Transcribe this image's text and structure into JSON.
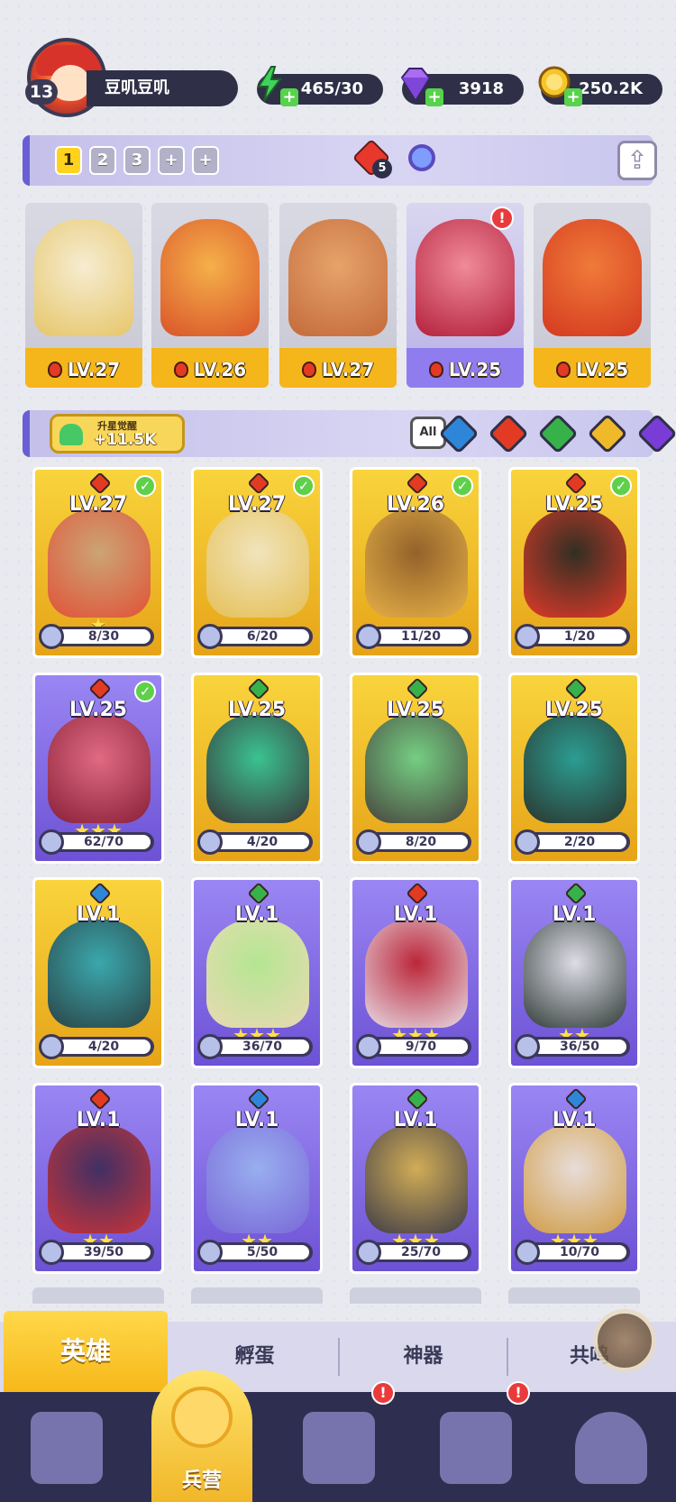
{
  "player": {
    "level": "13",
    "name": "豆叽豆叽"
  },
  "resources": [
    {
      "icon": "energy-icon",
      "value": "465/30"
    },
    {
      "icon": "diamond-icon",
      "value": "3918"
    },
    {
      "icon": "gold-coin-icon",
      "value": "250.2K"
    }
  ],
  "team_bar": {
    "slots": [
      "1",
      "2",
      "3"
    ],
    "gem_count": "5"
  },
  "team": [
    {
      "level": "LV.27",
      "element": "fire",
      "colors": [
        "#e6c66a",
        "#f6ecd0"
      ]
    },
    {
      "level": "LV.26",
      "element": "fire",
      "colors": [
        "#d9542a",
        "#f5b04a"
      ]
    },
    {
      "level": "LV.27",
      "element": "fire",
      "colors": [
        "#c46a3a",
        "#e6a36a"
      ]
    },
    {
      "level": "LV.25",
      "element": "fire",
      "colors": [
        "#b3203a",
        "#f08a9a"
      ],
      "alert": "!"
    },
    {
      "level": "LV.25",
      "element": "fire",
      "colors": [
        "#d43a1f",
        "#f07a3a"
      ]
    }
  ],
  "awaken": {
    "title": "升星觉醒",
    "value": "+11.5K"
  },
  "filters": {
    "all_label": "All",
    "elements": [
      "water",
      "fire",
      "wind",
      "light",
      "dark"
    ]
  },
  "element_colors": {
    "fire": "#e33a23",
    "water": "#2e86d9",
    "wind": "#37b24a",
    "light": "#f0b92a",
    "dark": "#7a3cd6"
  },
  "heroes": [
    {
      "level": "LV.27",
      "element": "fire",
      "bg": "gold",
      "progress": "8/30",
      "stars": "★",
      "check": true,
      "art": [
        "#c8a27a",
        "#e04a3a"
      ]
    },
    {
      "level": "LV.27",
      "element": "fire",
      "bg": "gold",
      "progress": "6/20",
      "stars": "",
      "check": true,
      "art": [
        "#f1e7c9",
        "#e4c15a"
      ]
    },
    {
      "level": "LV.26",
      "element": "fire",
      "bg": "gold",
      "progress": "11/20",
      "stars": "",
      "check": true,
      "art": [
        "#8a5a2a",
        "#e6b04a"
      ]
    },
    {
      "level": "LV.25",
      "element": "fire",
      "bg": "gold",
      "progress": "1/20",
      "stars": "",
      "check": true,
      "art": [
        "#222",
        "#e0302a"
      ]
    },
    {
      "level": "LV.25",
      "element": "fire",
      "bg": "violet",
      "progress": "62/70",
      "stars": "★★★",
      "check": true,
      "art": [
        "#e86a7a",
        "#8a1a2a"
      ]
    },
    {
      "level": "LV.25",
      "element": "wind",
      "bg": "gold",
      "progress": "4/20",
      "stars": "",
      "check": false,
      "art": [
        "#2ac39a",
        "#2a2a3a"
      ]
    },
    {
      "level": "LV.25",
      "element": "wind",
      "bg": "gold",
      "progress": "8/20",
      "stars": "",
      "check": false,
      "art": [
        "#6ad08a",
        "#3a3a40"
      ]
    },
    {
      "level": "LV.25",
      "element": "wind",
      "bg": "gold",
      "progress": "2/20",
      "stars": "",
      "check": false,
      "art": [
        "#1a9a9a",
        "#1a2a30"
      ]
    },
    {
      "level": "LV.1",
      "element": "water",
      "bg": "gold",
      "progress": "4/20",
      "stars": "",
      "check": false,
      "art": [
        "#2aa6b8",
        "#1a3a4a"
      ]
    },
    {
      "level": "LV.1",
      "element": "wind",
      "bg": "violet",
      "progress": "36/70",
      "stars": "★★★",
      "check": false,
      "art": [
        "#b8f08a",
        "#f3e4b0"
      ]
    },
    {
      "level": "LV.1",
      "element": "fire",
      "bg": "violet",
      "progress": "9/70",
      "stars": "★★★",
      "check": false,
      "art": [
        "#c0202a",
        "#f0e6e6"
      ]
    },
    {
      "level": "LV.1",
      "element": "wind",
      "bg": "violet",
      "progress": "36/50",
      "stars": "★★",
      "check": false,
      "art": [
        "#e6e6e6",
        "#2a3a2a"
      ]
    },
    {
      "level": "LV.1",
      "element": "fire",
      "bg": "violet",
      "progress": "39/50",
      "stars": "★★",
      "check": false,
      "art": [
        "#3a2a5a",
        "#d0302a"
      ]
    },
    {
      "level": "LV.1",
      "element": "water",
      "bg": "violet",
      "progress": "5/50",
      "stars": "★★",
      "check": false,
      "art": [
        "#9ab4f0",
        "#7a6ad8"
      ]
    },
    {
      "level": "LV.1",
      "element": "wind",
      "bg": "violet",
      "progress": "25/70",
      "stars": "★★★",
      "check": false,
      "art": [
        "#d8b24a",
        "#3a3a3a"
      ]
    },
    {
      "level": "LV.1",
      "element": "water",
      "bg": "violet",
      "progress": "10/70",
      "stars": "★★★",
      "check": false,
      "art": [
        "#f0e6d8",
        "#d8a23a"
      ]
    }
  ],
  "subtabs": [
    "英雄",
    "孵蛋",
    "神器",
    "共鸣"
  ],
  "nav": {
    "active_label": "兵营",
    "alerts": [
      "!",
      "!"
    ]
  }
}
